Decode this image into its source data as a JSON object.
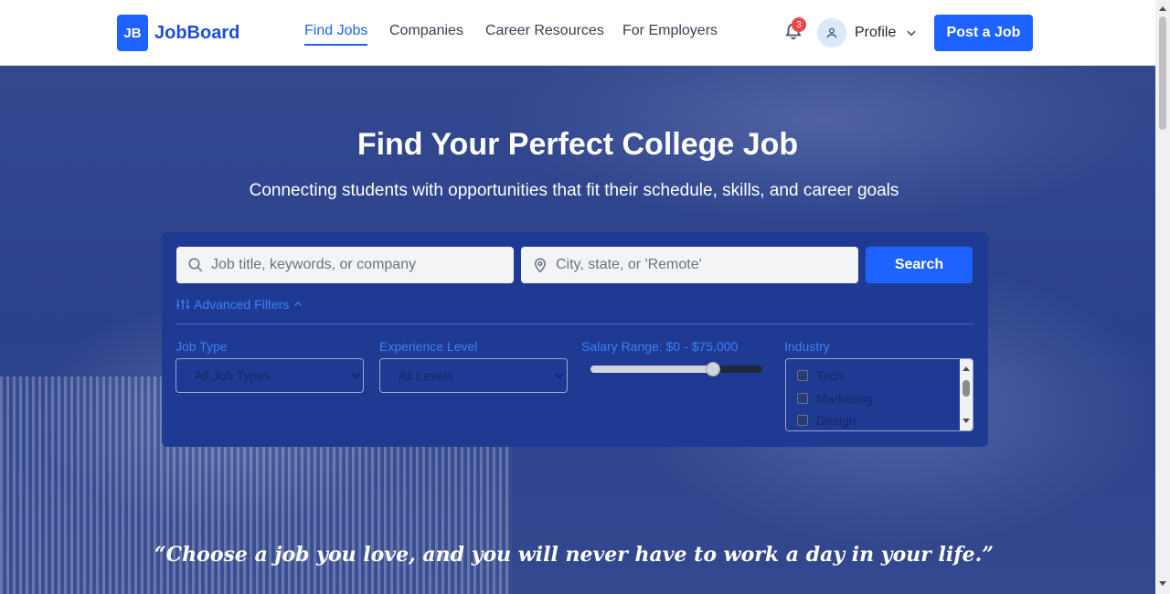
{
  "brand": {
    "badge": "JB",
    "name": "JobBoard"
  },
  "nav": {
    "items": [
      {
        "label": "Find Jobs",
        "active": true
      },
      {
        "label": "Companies"
      },
      {
        "label": "Career Resources"
      },
      {
        "label": "For Employers"
      }
    ]
  },
  "notifications": {
    "count": "3"
  },
  "profile": {
    "label": "Profile"
  },
  "header": {
    "post_job_label": "Post a Job"
  },
  "hero": {
    "title": "Find Your Perfect College Job",
    "subtitle": "Connecting students with opportunities that fit their schedule, skills, and career goals"
  },
  "search": {
    "keyword_placeholder": "Job title, keywords, or company",
    "location_placeholder": "City, state, or 'Remote'",
    "button_label": "Search",
    "advanced_label": "Advanced Filters"
  },
  "filters": {
    "job_type": {
      "label": "Job Type",
      "selected": "All Job Types"
    },
    "experience": {
      "label": "Experience Level",
      "selected": "All Levels"
    },
    "salary": {
      "label": "Salary Range: $0 - $75,000",
      "level_fraction": 0.73
    },
    "industry": {
      "label": "Industry",
      "options": [
        "Tech",
        "Marketing",
        "Design"
      ]
    }
  },
  "quote": "“Choose a job you love, and you will never have to work a day in your life.”",
  "colors": {
    "primary": "#1e62ff",
    "panel": "#1e3a93",
    "accent_text": "#3b82f6"
  }
}
